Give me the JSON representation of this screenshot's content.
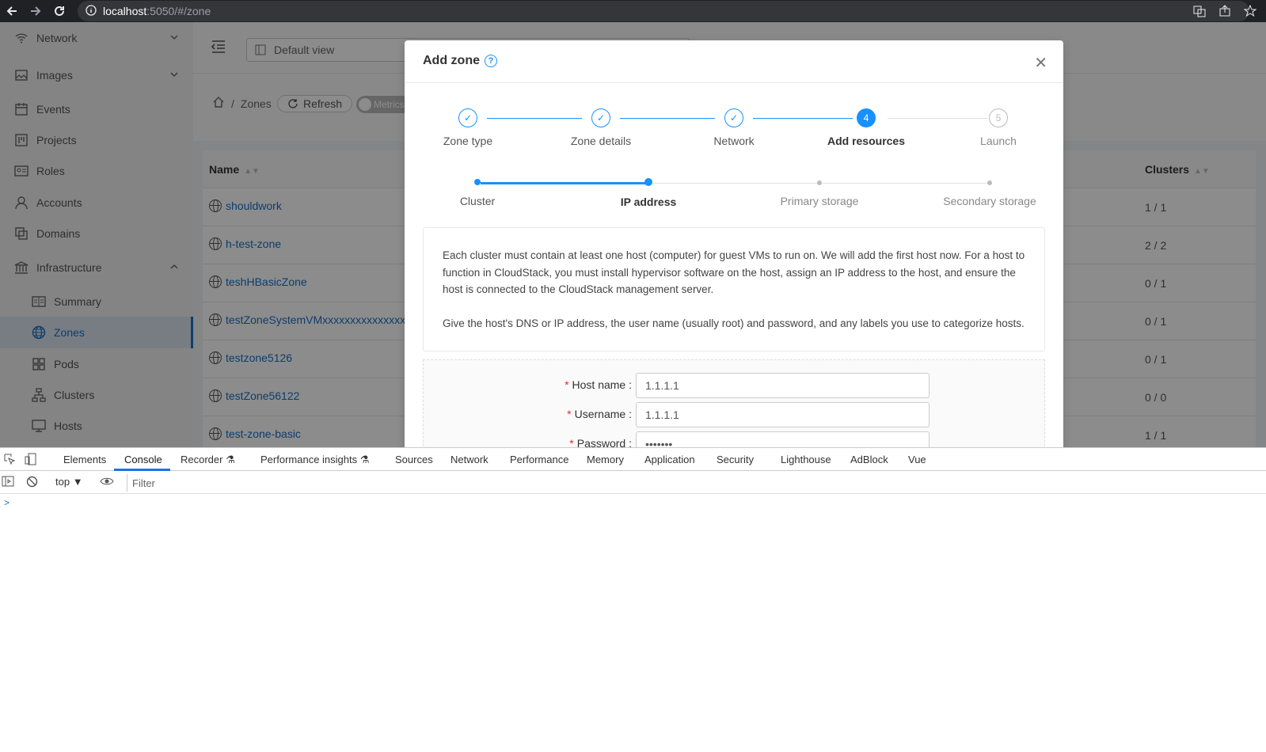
{
  "browser": {
    "url_host": "localhost",
    "url_path": ":5050/#/zone"
  },
  "sidebar": {
    "items": [
      {
        "label": "Network",
        "icon": "wifi-icon"
      },
      {
        "label": "Images",
        "icon": "picture-icon"
      },
      {
        "label": "Events",
        "icon": "calendar-icon"
      },
      {
        "label": "Projects",
        "icon": "project-icon"
      },
      {
        "label": "Roles",
        "icon": "idcard-icon"
      },
      {
        "label": "Accounts",
        "icon": "user-icon"
      },
      {
        "label": "Domains",
        "icon": "block-icon"
      },
      {
        "label": "Infrastructure",
        "icon": "bank-icon"
      },
      {
        "label": "Summary",
        "icon": "read-icon"
      },
      {
        "label": "Zones",
        "icon": "globe-icon"
      },
      {
        "label": "Pods",
        "icon": "appstore-icon"
      },
      {
        "label": "Clusters",
        "icon": "cluster-icon"
      },
      {
        "label": "Hosts",
        "icon": "desktop-icon"
      }
    ]
  },
  "header": {
    "view_select": "Default view"
  },
  "breadcrumb": {
    "current": "Zones",
    "separator": "/",
    "refresh_label": "Refresh",
    "metrics_label": "Metrics"
  },
  "table": {
    "columns": {
      "name": "Name",
      "clusters": "Clusters"
    },
    "rows": [
      {
        "name": "shouldwork",
        "clusters": "1 / 1"
      },
      {
        "name": "h-test-zone",
        "clusters": "2 / 2"
      },
      {
        "name": "teshHBasicZone",
        "clusters": "0 / 1"
      },
      {
        "name": "testZoneSystemVMxxxxxxxxxxxxxxxxxx",
        "clusters": "0 / 1"
      },
      {
        "name": "testzone5126",
        "clusters": "0 / 1"
      },
      {
        "name": "testZone56122",
        "clusters": "0 / 0"
      },
      {
        "name": "test-zone-basic",
        "clusters": "1 / 1"
      }
    ]
  },
  "modal": {
    "title": "Add zone",
    "help_glyph": "?",
    "close_glyph": "✕",
    "steps": [
      {
        "label": "Zone type",
        "status": "done",
        "glyph": "✓"
      },
      {
        "label": "Zone details",
        "status": "done",
        "glyph": "✓"
      },
      {
        "label": "Network",
        "status": "done",
        "glyph": "✓"
      },
      {
        "label": "Add resources",
        "status": "active",
        "glyph": "4"
      },
      {
        "label": "Launch",
        "status": "wait",
        "glyph": "5"
      }
    ],
    "substeps": [
      {
        "label": "Cluster",
        "status": "done"
      },
      {
        "label": "IP address",
        "status": "active"
      },
      {
        "label": "Primary storage",
        "status": "wait"
      },
      {
        "label": "Secondary storage",
        "status": "wait"
      }
    ],
    "info_p1": "Each cluster must contain at least one host (computer) for guest VMs to run on. We will add the first host now. For a host to function in CloudStack, you must install hypervisor software on the host, assign an IP address to the host, and ensure the host is connected to the CloudStack management server.",
    "info_p2": "Give the host's DNS or IP address, the user name (usually root) and password, and any labels you use to categorize hosts.",
    "form": {
      "host_label": "Host name",
      "host_value": "1.1.1.1",
      "username_label": "Username",
      "username_value": "1.1.1.1",
      "password_label": "Password",
      "password_value": "•••••••"
    }
  },
  "devtools": {
    "tabs": [
      "Elements",
      "Console",
      "Recorder",
      "Performance insights",
      "Sources",
      "Network",
      "Performance",
      "Memory",
      "Application",
      "Security",
      "Lighthouse",
      "AdBlock",
      "Vue"
    ],
    "active_tab": "Console",
    "context": "top",
    "filter_placeholder": "Filter",
    "prompt": ">"
  }
}
